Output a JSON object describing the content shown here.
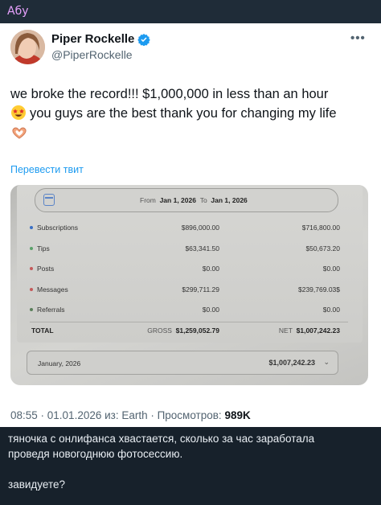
{
  "sender_name": "Абу",
  "tweet": {
    "name": "Piper Rockelle",
    "handle": "@PiperRockelle",
    "more_icon": "more-horizontal-icon",
    "text_line1": "we broke the record!!! $1,000,000 in less than an hour",
    "text_line2": "you guys are the best thank you for changing my life",
    "translate_link": "Перевести твит",
    "meta_prefix": "08:55 · 01.01.2026 из: Earth · Просмотров: ",
    "views": "989K"
  },
  "screenshot": {
    "date_from_label": "From",
    "date_from": "Jan 1, 2026",
    "date_to_label": "To",
    "date_to": "Jan 1, 2026",
    "rows": [
      {
        "label": "Subscriptions",
        "gross": "$896,000.00",
        "net": "$716,800.00",
        "color": "#3a6fc4"
      },
      {
        "label": "Tips",
        "gross": "$63,341.50",
        "net": "$50,673.20",
        "color": "#5aa06a"
      },
      {
        "label": "Posts",
        "gross": "$0.00",
        "net": "$0.00",
        "color": "#c45a5a"
      },
      {
        "label": "Messages",
        "gross": "$299,711.29",
        "net": "$239,769.03$",
        "color": "#c45a5a"
      },
      {
        "label": "Referrals",
        "gross": "$0.00",
        "net": "$0.00",
        "color": "#5a7f5a"
      }
    ],
    "total": {
      "label": "TOTAL",
      "gross_label": "GROSS",
      "gross": "$1,259,052.79",
      "net_label": "NET",
      "net": "$1,007,242.23"
    },
    "month": "January, 2026",
    "month_total": "$1,007,242.23"
  },
  "caption": {
    "line1": "тяночка с онлифанса хвастается, сколько за час заработала",
    "line2": "проведя новогоднюю фотосессию.",
    "line3": "завидуете?"
  }
}
